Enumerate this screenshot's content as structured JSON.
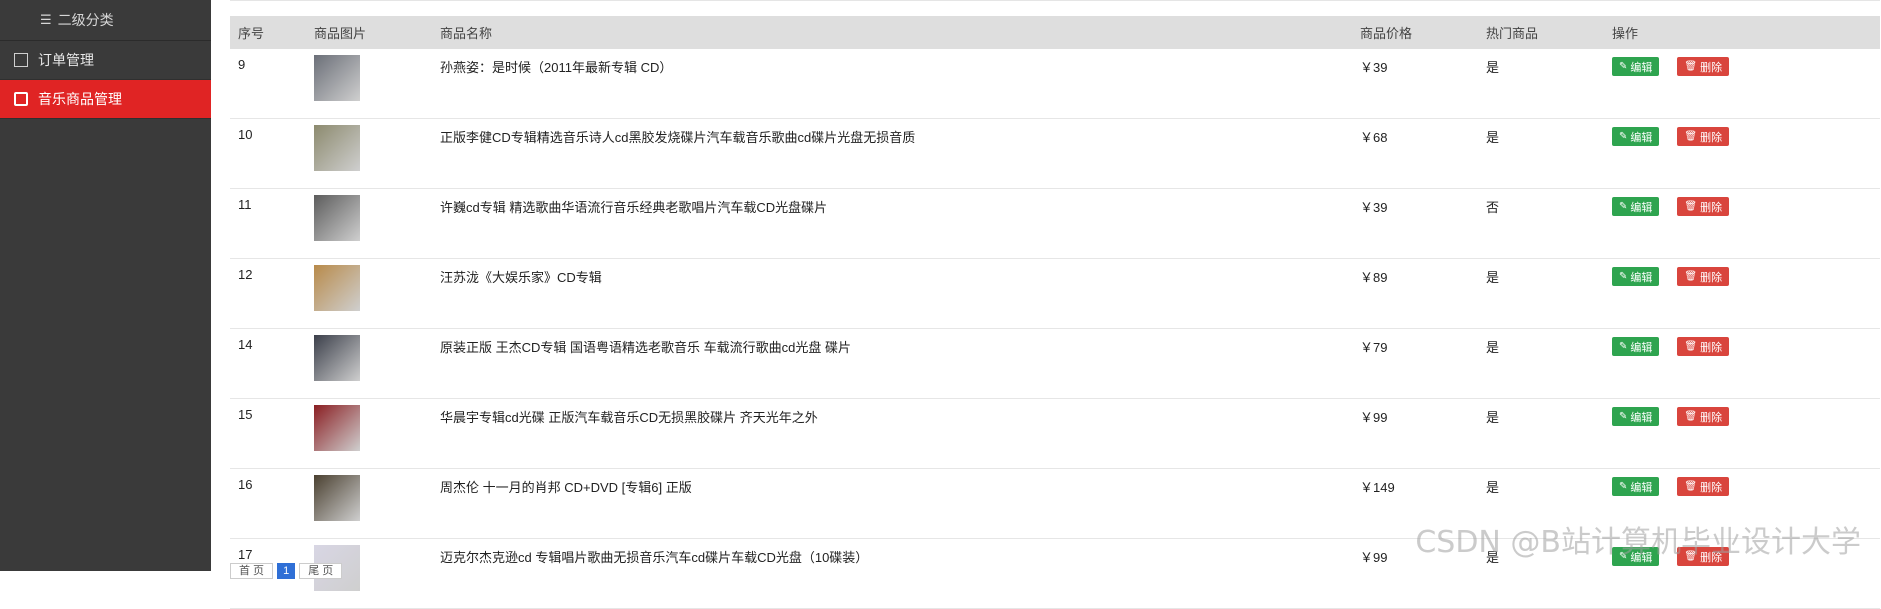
{
  "sidebar": {
    "sub_label": "二级分类",
    "items": [
      {
        "label": "订单管理"
      },
      {
        "label": "音乐商品管理"
      }
    ]
  },
  "table": {
    "headers": [
      "序号",
      "商品图片",
      "商品名称",
      "商品价格",
      "热门商品",
      "操作"
    ],
    "edit_label": "编辑",
    "delete_label": "删除",
    "rows": [
      {
        "id": "9",
        "name": "孙燕姿：是时候（2011年最新专辑 CD）",
        "price": "￥39",
        "hot": "是",
        "thumb_color": "#6b6f78"
      },
      {
        "id": "10",
        "name": "正版李健CD专辑精选音乐诗人cd黑胶发烧碟片汽车载音乐歌曲cd碟片光盘无损音质",
        "price": "￥68",
        "hot": "是",
        "thumb_color": "#8c8a6e"
      },
      {
        "id": "11",
        "name": "许巍cd专辑 精选歌曲华语流行音乐经典老歌唱片汽车载CD光盘碟片",
        "price": "￥39",
        "hot": "否",
        "thumb_color": "#5c5c5c"
      },
      {
        "id": "12",
        "name": "汪苏泷《大娱乐家》CD专辑",
        "price": "￥89",
        "hot": "是",
        "thumb_color": "#b88a4a"
      },
      {
        "id": "14",
        "name": "原装正版 王杰CD专辑 国语粤语精选老歌音乐 车载流行歌曲cd光盘 碟片",
        "price": "￥79",
        "hot": "是",
        "thumb_color": "#3b3f4a"
      },
      {
        "id": "15",
        "name": "华晨宇专辑cd光碟 正版汽车载音乐CD无损黑胶碟片 齐天光年之外",
        "price": "￥99",
        "hot": "是",
        "thumb_color": "#8a1e22"
      },
      {
        "id": "16",
        "name": "周杰伦 十一月的肖邦 CD+DVD [专辑6] 正版",
        "price": "￥149",
        "hot": "是",
        "thumb_color": "#4a4030"
      },
      {
        "id": "17",
        "name": "迈克尔杰克逊cd 专辑唱片歌曲无损音乐汽车cd碟片车载CD光盘（10碟装）",
        "price": "￥99",
        "hot": "是",
        "thumb_color": "#d8d6e4"
      }
    ]
  },
  "pager": {
    "first": "首 页",
    "current": "1",
    "last": "尾 页"
  },
  "watermark": "CSDN @B站计算机毕业设计大学",
  "colors": {
    "sidebar_bg": "#3a3a3a",
    "active": "#e02424",
    "edit": "#2ea44f",
    "delete": "#d9453d",
    "hot": "#e32222"
  }
}
